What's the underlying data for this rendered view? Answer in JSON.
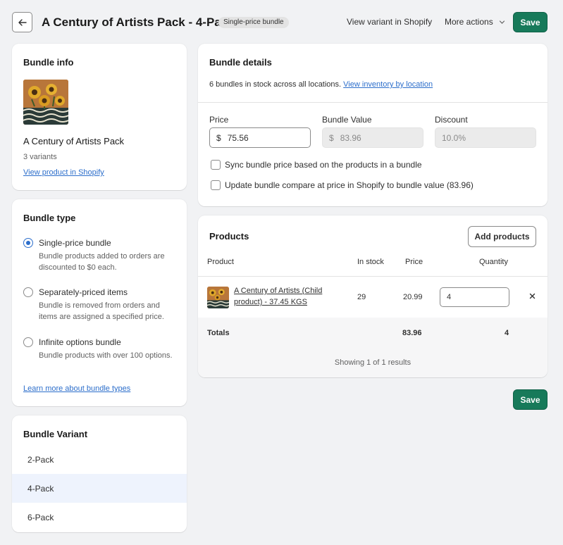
{
  "header": {
    "title": "A Century of Artists Pack - 4-Pack",
    "badge": "Single-price bundle",
    "view_variant": "View variant in Shopify",
    "more_actions": "More actions",
    "save": "Save"
  },
  "bundle_info": {
    "title": "Bundle info",
    "product_name": "A Century of Artists Pack",
    "variants": "3 variants",
    "view_link": "View product in Shopify"
  },
  "bundle_type": {
    "title": "Bundle type",
    "options": [
      {
        "label": "Single-price bundle",
        "desc": "Bundle products added to orders are discounted to $0 each.",
        "selected": true
      },
      {
        "label": "Separately-priced items",
        "desc": "Bundle is removed from orders and items are assigned a specified price.",
        "selected": false
      },
      {
        "label": "Infinite options bundle",
        "desc": "Bundle products with over 100 options.",
        "selected": false
      }
    ],
    "learn_more": "Learn more about bundle types"
  },
  "bundle_variant": {
    "title": "Bundle Variant",
    "items": [
      "2-Pack",
      "4-Pack",
      "6-Pack"
    ],
    "selected": "4-Pack"
  },
  "bundle_details": {
    "title": "Bundle details",
    "stock_text": "6 bundles in stock across all locations.",
    "inventory_link": "View inventory by location",
    "price_label": "Price",
    "price_currency": "$",
    "price_value": "75.56",
    "value_label": "Bundle Value",
    "value_currency": "$",
    "value_value": "83.96",
    "discount_label": "Discount",
    "discount_value": "10.0%",
    "sync_label": "Sync bundle price based on the products in a bundle",
    "update_label": "Update bundle compare at price in Shopify to bundle value (83.96)"
  },
  "products": {
    "title": "Products",
    "add_button": "Add products",
    "columns": {
      "product": "Product",
      "in_stock": "In stock",
      "price": "Price",
      "quantity": "Quantity"
    },
    "rows": [
      {
        "name_line1": "A Century of Artists (Child",
        "name_line2": "product) - 37.45 KGS",
        "in_stock": "29",
        "price": "20.99",
        "quantity": "4"
      }
    ],
    "totals_label": "Totals",
    "totals_price": "83.96",
    "totals_quantity": "4",
    "showing": "Showing 1 of 1 results"
  },
  "colors": {
    "primary": "#177a5a",
    "link": "#2c6ecb",
    "selected_bg": "#eef3fd"
  },
  "icons": {
    "back": "arrow-left-icon",
    "more": "chevron-down-icon",
    "remove": "close-icon"
  }
}
